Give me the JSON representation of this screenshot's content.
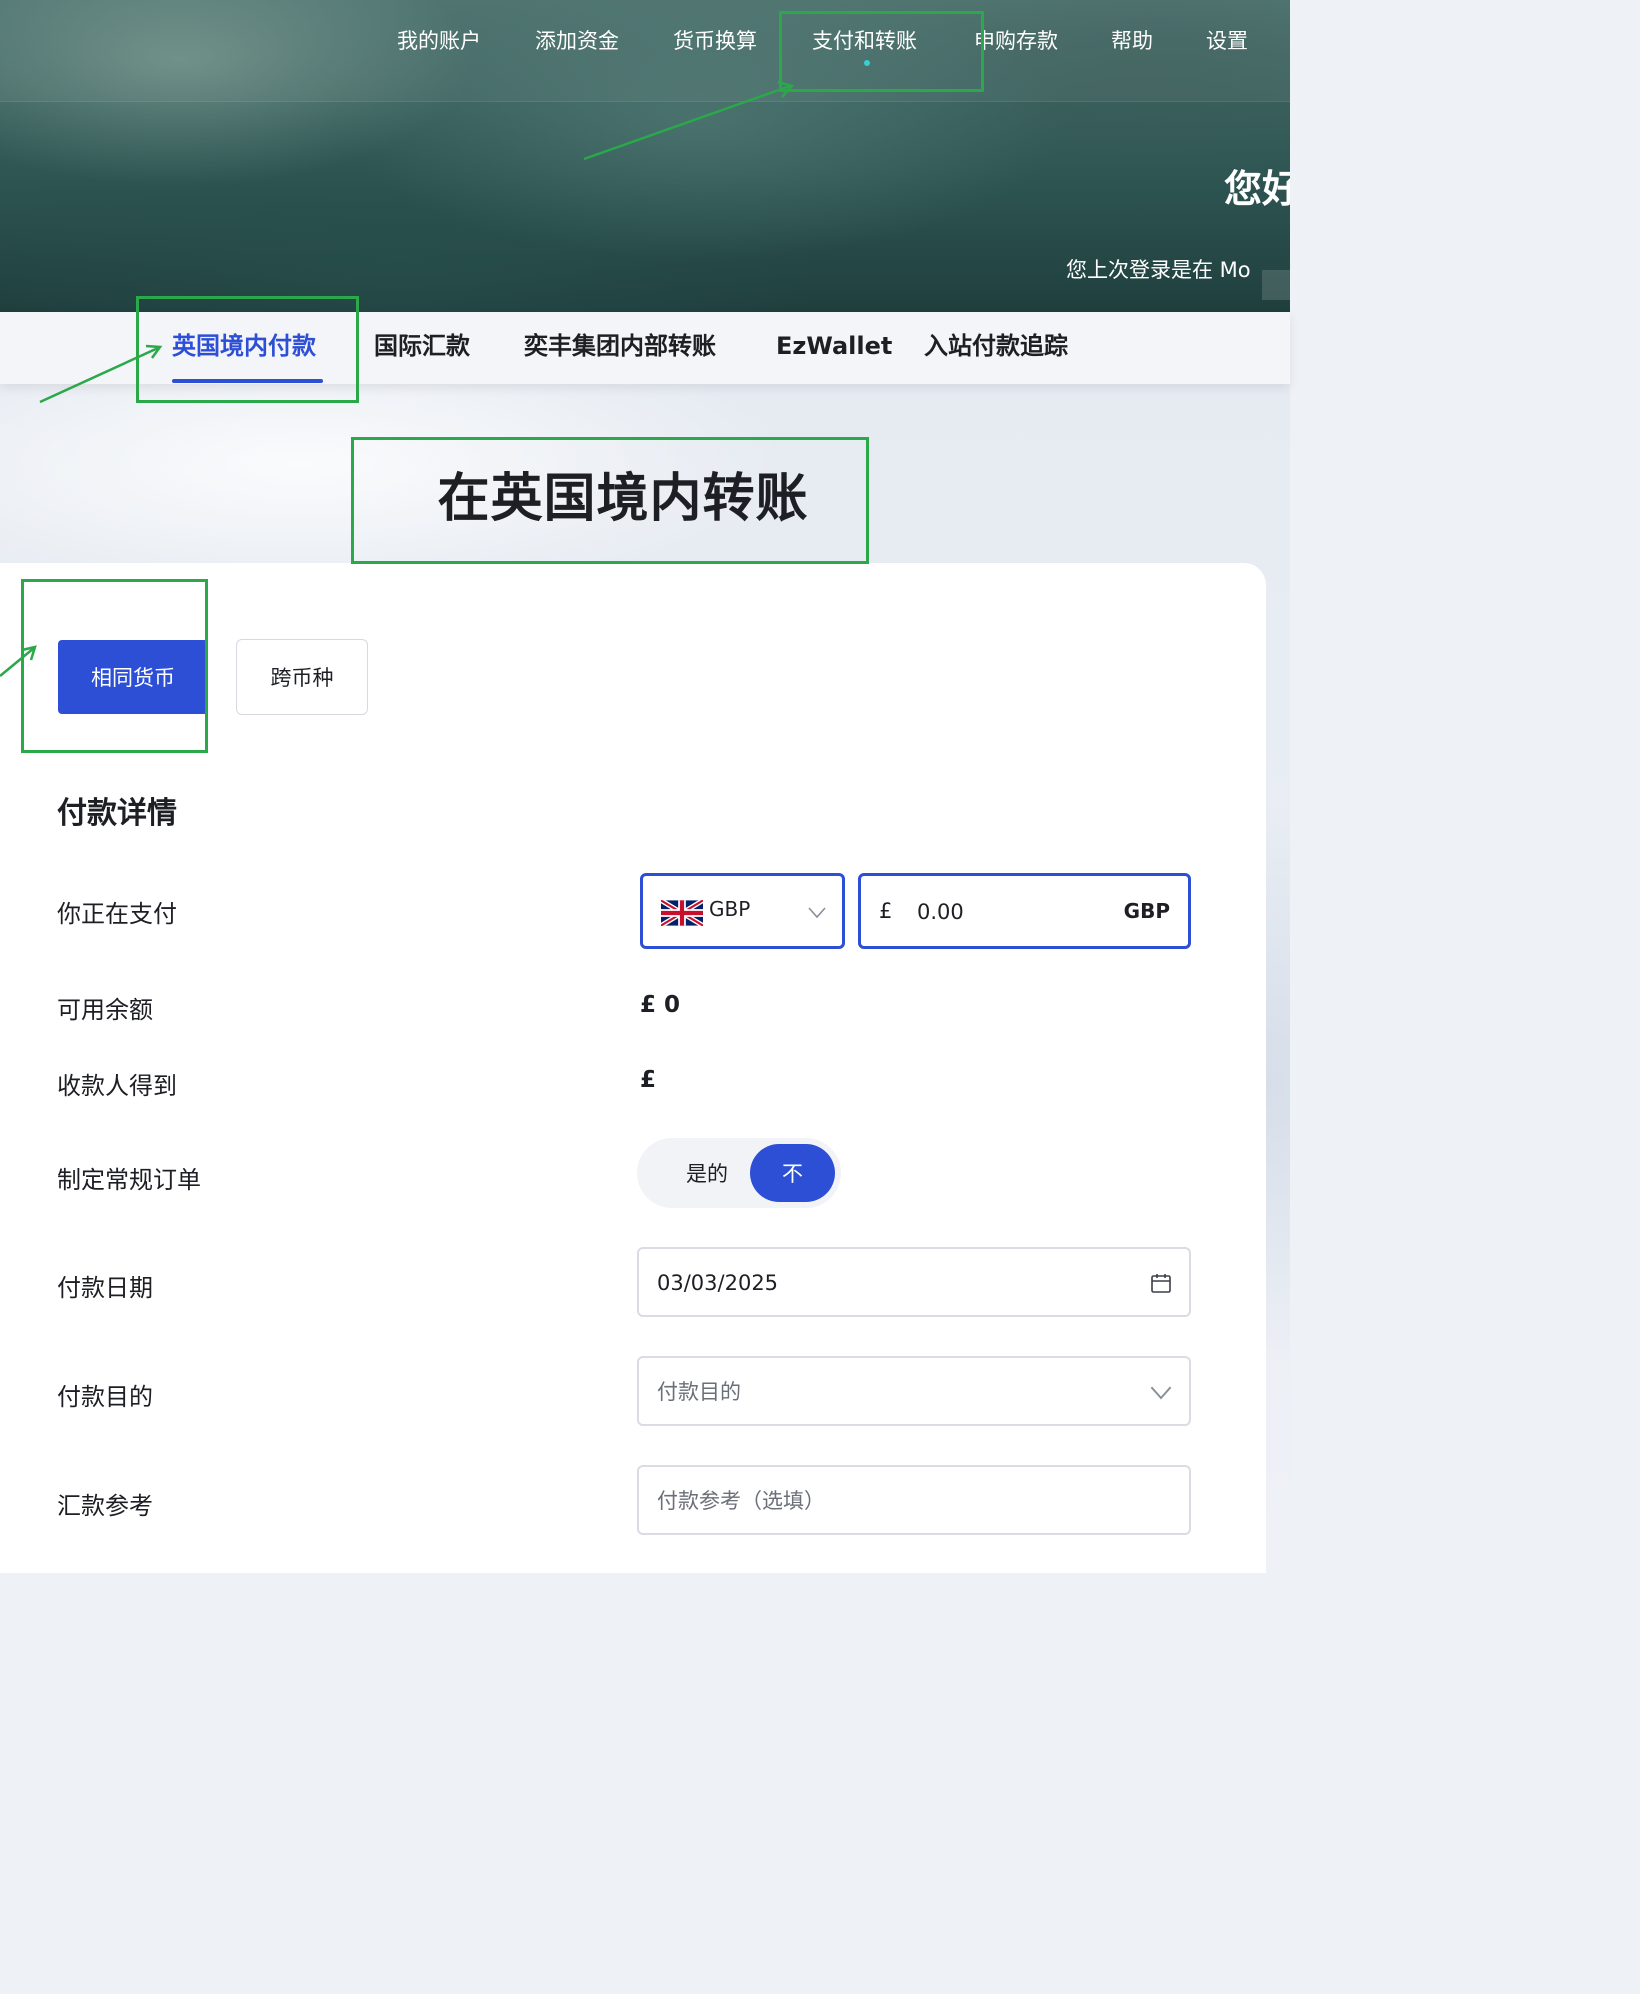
{
  "topnav": {
    "items": [
      {
        "label": "我的账户"
      },
      {
        "label": "添加资金"
      },
      {
        "label": "货币换算"
      },
      {
        "label": "支付和转账"
      },
      {
        "label": "申购存款"
      },
      {
        "label": "帮助"
      },
      {
        "label": "设置"
      }
    ]
  },
  "hero": {
    "greeting": "您好",
    "last_login": "您上次登录是在 Mo"
  },
  "subnav": {
    "items": [
      {
        "label": "英国境内付款"
      },
      {
        "label": "国际汇款"
      },
      {
        "label": "奕丰集团内部转账"
      },
      {
        "label": "EzWallet"
      },
      {
        "label": "入站付款追踪"
      }
    ]
  },
  "page": {
    "title": "在英国境内转账"
  },
  "currency_mode": {
    "same_label": "相同货币",
    "cross_label": "跨币种"
  },
  "form": {
    "section_title": "付款详情",
    "pay_label": "你正在支付",
    "currency_code": "GBP",
    "amount_symbol": "£",
    "amount_value": "0.00",
    "amount_unit": "GBP",
    "balance_label": "可用余额",
    "balance_value": "£ 0",
    "receive_label": "收款人得到",
    "receive_value": "£",
    "standing_label": "制定常规订单",
    "standing_yes": "是的",
    "standing_no": "不",
    "date_label": "付款日期",
    "date_value": "03/03/2025",
    "purpose_label": "付款目的",
    "purpose_placeholder": "付款目的",
    "reference_label": "汇款参考",
    "reference_placeholder": "付款参考（选填）"
  },
  "colors": {
    "accent": "#2c4fd6",
    "annotation": "#2aa84a"
  },
  "icons": {
    "flag": "uk-flag-icon",
    "chevron": "chevron-down-icon",
    "calendar": "calendar-icon"
  }
}
